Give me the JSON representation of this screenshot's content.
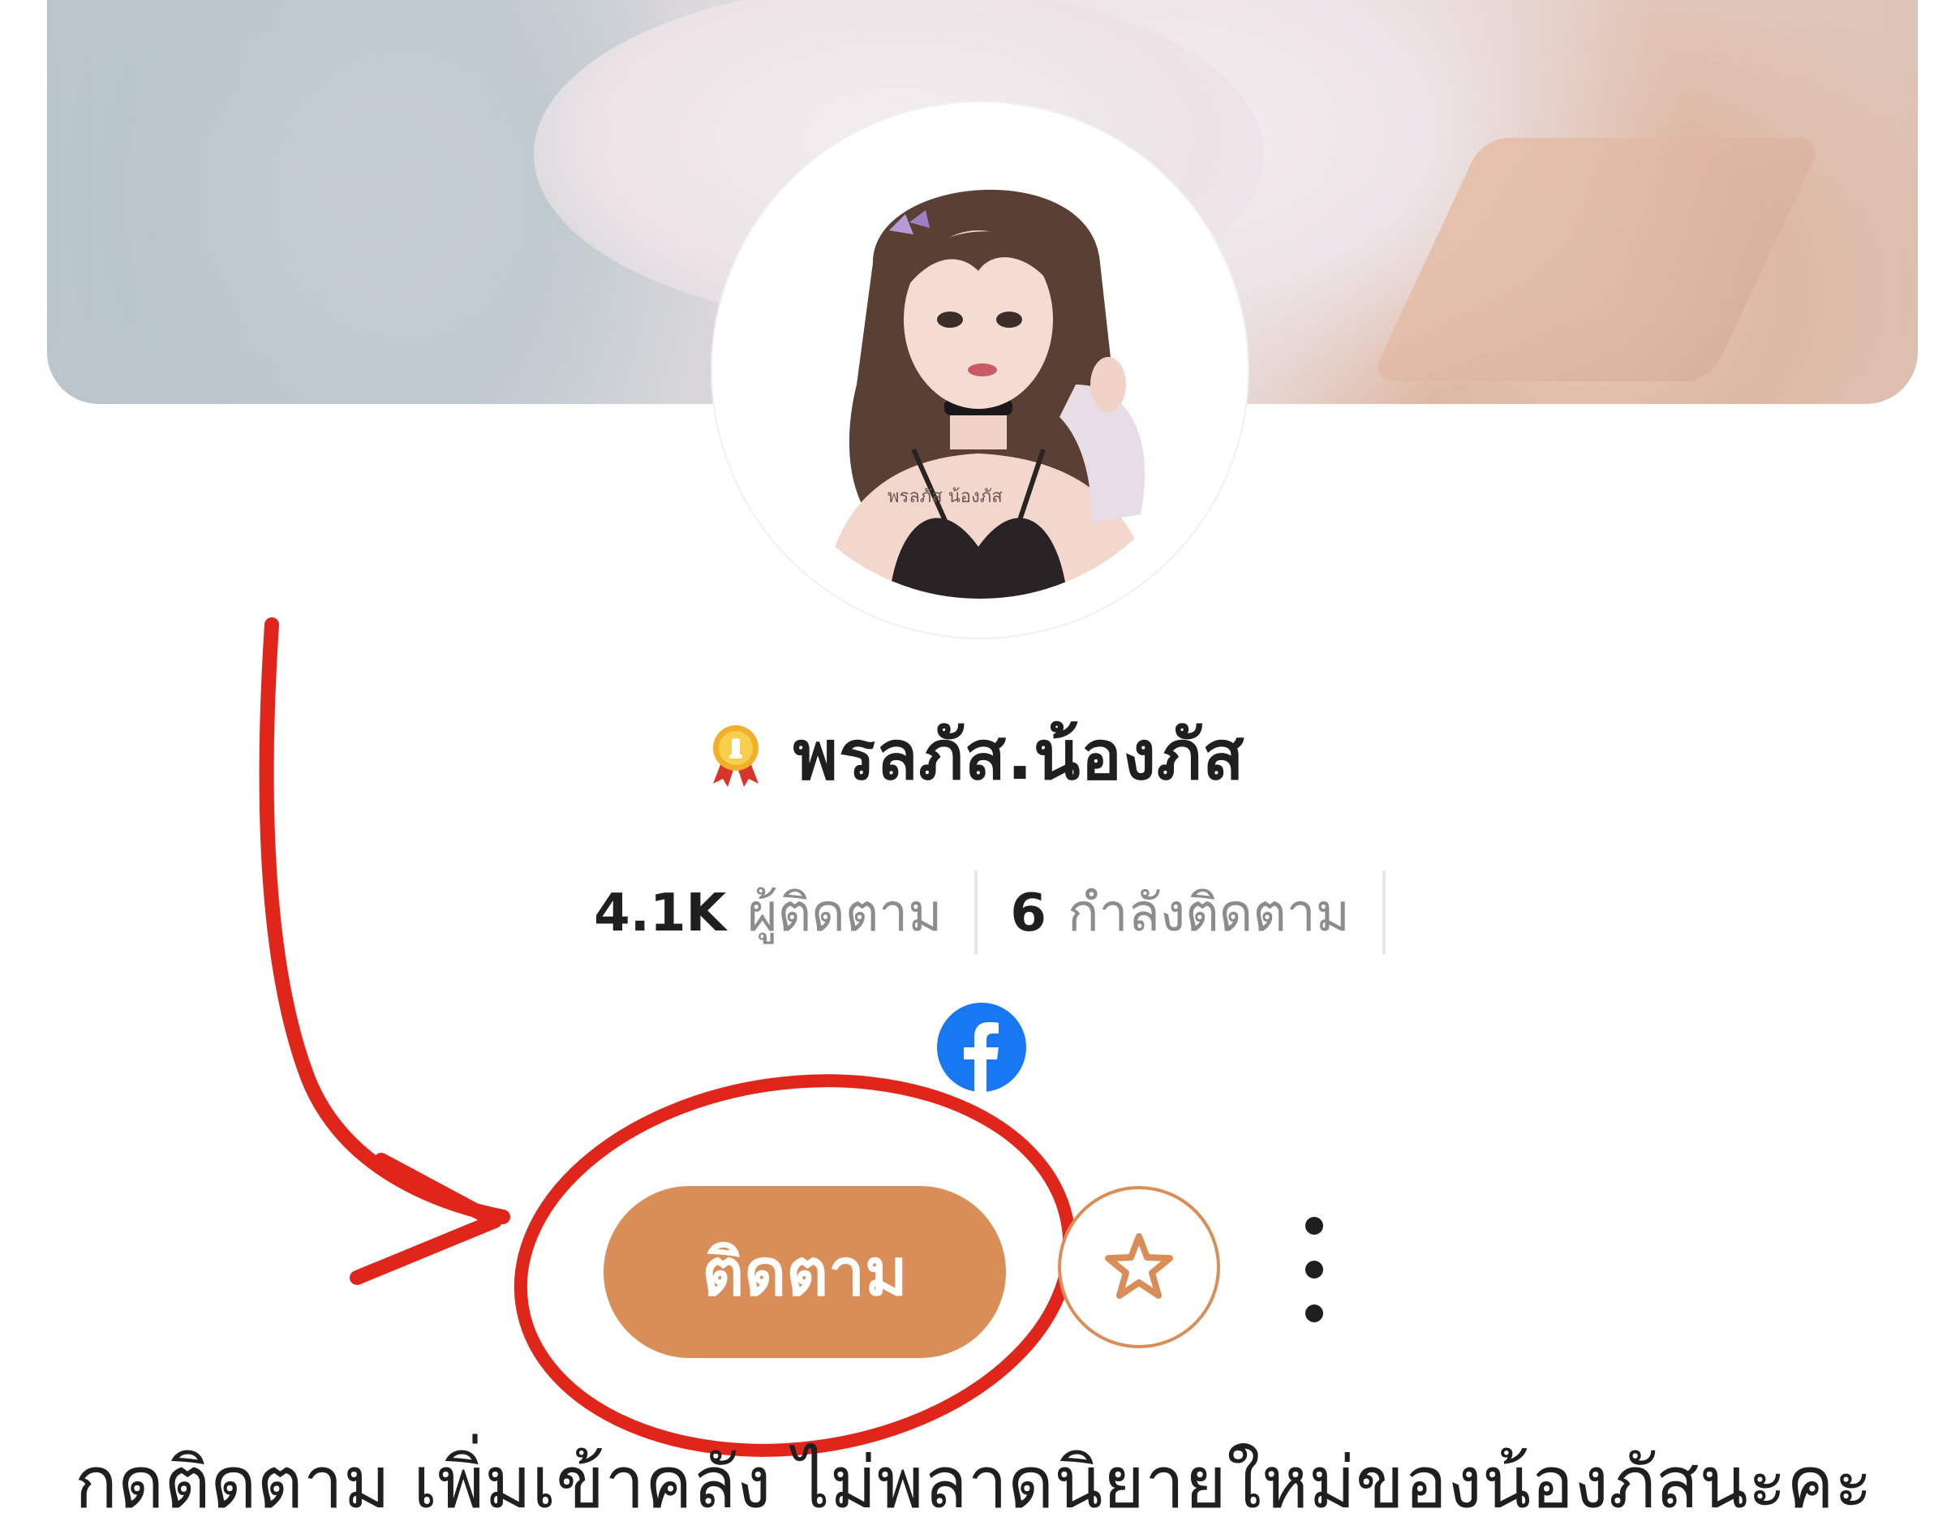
{
  "profile": {
    "name": "พรลภัส.น้องภัส",
    "avatar_watermark": "พรลภัส น้องภัส",
    "badge_icon": "gold-medal-icon"
  },
  "stats": {
    "followers_count": "4.1K",
    "followers_label": "ผู้ติดตาม",
    "following_count": "6",
    "following_label": "กำลังติดตาม"
  },
  "social": {
    "facebook_icon": "facebook-icon"
  },
  "actions": {
    "follow_label": "ติดตาม",
    "favorite_icon": "star-icon",
    "more_icon": "more-vertical-icon"
  },
  "caption": "กดติดตาม เพิ่มเข้าคลัง ไม่พลาดนิยายใหม่ของน้องภัสนะคะ",
  "colors": {
    "accent": "#d98e57",
    "annotation": "#e0261b",
    "facebook": "#1877f2",
    "text_primary": "#1f1f1f",
    "text_secondary": "#8c8c8c"
  }
}
